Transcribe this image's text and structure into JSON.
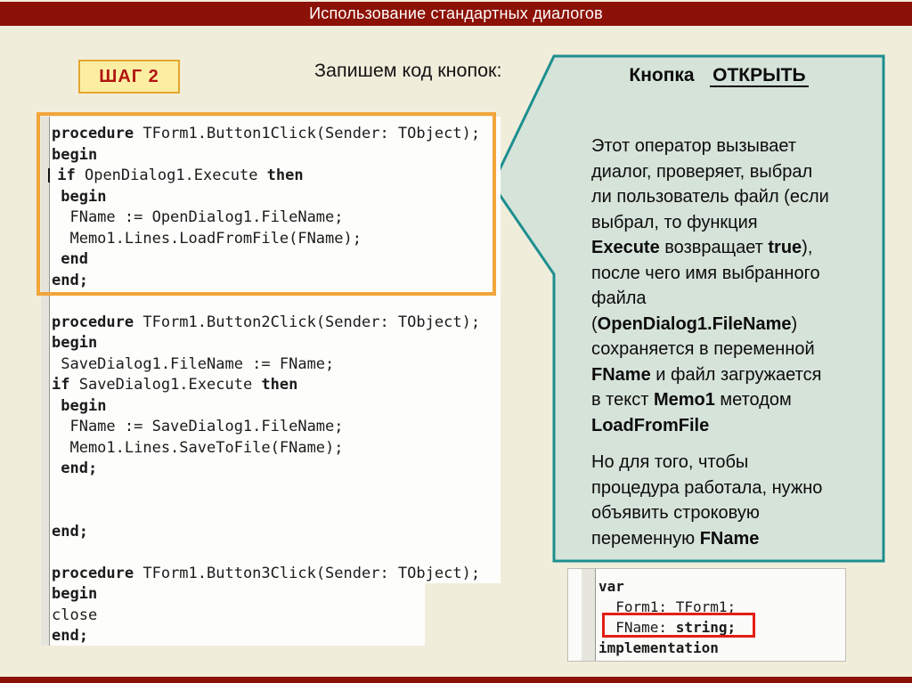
{
  "slide_title": "Использование стандартных диалогов",
  "badge": {
    "label": "ШАГ 2"
  },
  "caption": "Запишем код кнопок:",
  "colors": {
    "maroon": "#8C1106",
    "cream": "#F1EDDB",
    "teal_border": "#1D8F8F",
    "teal_fill": "#D6E3D9",
    "orange": "#F2A53A",
    "badge_fill": "#FBEEA3",
    "badge_border": "#E4A52F",
    "badge_text": "#B21410",
    "red_box": "#E41E14"
  },
  "code_panel": {
    "lines": [
      [
        {
          "t": "procedure",
          "b": true
        },
        {
          "t": " TForm1.Button1Click(Sender: TObject);"
        }
      ],
      [
        {
          "t": "begin",
          "b": true
        }
      ],
      [
        {
          "caret": true
        },
        {
          "t": " "
        },
        {
          "t": "if",
          "b": true
        },
        {
          "t": " OpenDialog1.Execute "
        },
        {
          "t": "then",
          "b": true
        }
      ],
      [
        {
          "t": " "
        },
        {
          "t": "begin",
          "b": true
        }
      ],
      [
        {
          "t": "  FName := OpenDialog1.FileName;"
        }
      ],
      [
        {
          "t": "  Memo1.Lines.LoadFromFile(FName);"
        }
      ],
      [
        {
          "t": " "
        },
        {
          "t": "end",
          "b": true
        }
      ],
      [
        {
          "t": "end;",
          "b": true
        }
      ],
      [],
      [
        {
          "t": "procedure",
          "b": true
        },
        {
          "t": " TForm1.Button2Click(Sender: TObject);"
        }
      ],
      [
        {
          "t": "begin",
          "b": true
        }
      ],
      [
        {
          "t": " SaveDialog1.FileName := FName;"
        }
      ],
      [
        {
          "t": "if",
          "b": true
        },
        {
          "t": " SaveDialog1.Execute "
        },
        {
          "t": "then",
          "b": true
        }
      ],
      [
        {
          "t": " "
        },
        {
          "t": "begin",
          "b": true
        }
      ],
      [
        {
          "t": "  FName := SaveDialog1.FileName;"
        }
      ],
      [
        {
          "t": "  Memo1.Lines.SaveToFile(FName);"
        }
      ],
      [
        {
          "t": " "
        },
        {
          "t": "end;",
          "b": true
        }
      ],
      [],
      [],
      [
        {
          "t": "end;",
          "b": true
        }
      ],
      [],
      [
        {
          "t": "procedure",
          "b": true
        },
        {
          "t": " TForm1.Button3Click(Sender: TObject);"
        }
      ],
      [
        {
          "t": "begin",
          "b": true
        }
      ],
      [
        {
          "t": "close"
        }
      ],
      [
        {
          "t": "end;",
          "b": true
        }
      ]
    ]
  },
  "callout": {
    "title_prefix": "Кнопка",
    "title_button": "ОТКРЫТЬ",
    "paragraphs": [
      [
        {
          "t": " Этот оператор вызывает"
        },
        {
          "br": true
        },
        {
          "t": "диалог, проверяет, выбрал"
        },
        {
          "br": true
        },
        {
          "t": "ли пользователь файл (если"
        },
        {
          "br": true
        },
        {
          "t": "выбрал, то функция"
        },
        {
          "br": true
        },
        {
          "t": "Execute",
          "b": true
        },
        {
          "t": " возвращает "
        },
        {
          "t": "true",
          "b": true
        },
        {
          "t": "),"
        },
        {
          "br": true
        },
        {
          "t": "после чего имя выбранного"
        },
        {
          "br": true
        },
        {
          "t": "файла"
        },
        {
          "br": true
        },
        {
          "t": "("
        },
        {
          "t": "OpenDialog1.FileName",
          "b": true
        },
        {
          "t": ")"
        },
        {
          "br": true
        },
        {
          "t": "сохраняется в переменной"
        },
        {
          "br": true
        },
        {
          "t": "FName",
          "b": true
        },
        {
          "t": " и файл загружается"
        },
        {
          "br": true
        },
        {
          "t": "в текст "
        },
        {
          "t": "Memo1",
          "b": true
        },
        {
          "t": " методом"
        },
        {
          "br": true
        },
        {
          "t": "LoadFromFile",
          "b": true
        }
      ],
      [
        {
          "t": " Но для того, чтобы"
        },
        {
          "br": true
        },
        {
          "t": "процедура работала, нужно"
        },
        {
          "br": true
        },
        {
          "t": "объявить строковую"
        },
        {
          "br": true
        },
        {
          "t": "переменную "
        },
        {
          "t": "FName",
          "b": true
        }
      ]
    ]
  },
  "var_panel": {
    "lines": [
      [
        {
          "t": "var",
          "b": true
        }
      ],
      [
        {
          "t": "  Form1: TForm1;"
        }
      ],
      [
        {
          "t": "  FName: "
        },
        {
          "t": "string;",
          "b": true
        }
      ],
      [
        {
          "t": "implementation",
          "b": true
        }
      ]
    ]
  }
}
